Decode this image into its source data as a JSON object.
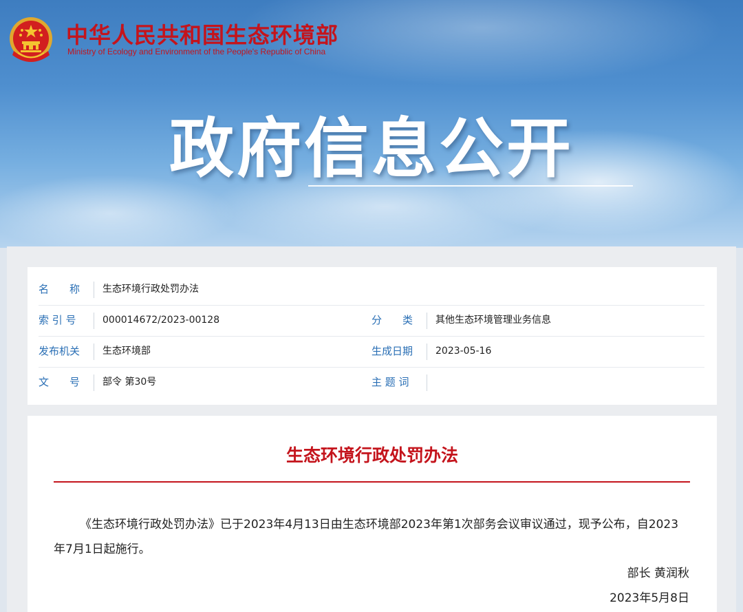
{
  "header": {
    "site_name_cn": "中华人民共和国生态环境部",
    "site_name_en": "Ministry of Ecology and Environment of the People's Republic of China",
    "emblem_icon": "national-emblem-icon"
  },
  "banner": {
    "title": "政府信息公开"
  },
  "meta": {
    "name_label": "名　　称",
    "name_value": "生态环境行政处罚办法",
    "index_label": "索 引 号",
    "index_value": "000014672/2023-00128",
    "category_label": "分　　类",
    "category_value": "其他生态环境管理业务信息",
    "issuer_label": "发布机关",
    "issuer_value": "生态环境部",
    "date_label": "生成日期",
    "date_value": "2023-05-16",
    "doc_no_label": "文　　号",
    "doc_no_value": "部令 第30号",
    "keywords_label": "主 题 词",
    "keywords_value": ""
  },
  "article": {
    "title": "生态环境行政处罚办法",
    "body": "《生态环境行政处罚办法》已于2023年4月13日由生态环境部2023年第1次部务会议审议通过，现予公布，自2023年7月1日起施行。",
    "signature": "部长 黄润秋",
    "date": "2023年5月8日"
  },
  "colors": {
    "brand_red": "#c4141c",
    "label_blue": "#2a6fb5",
    "sky_blue": "#4f8fcf"
  }
}
